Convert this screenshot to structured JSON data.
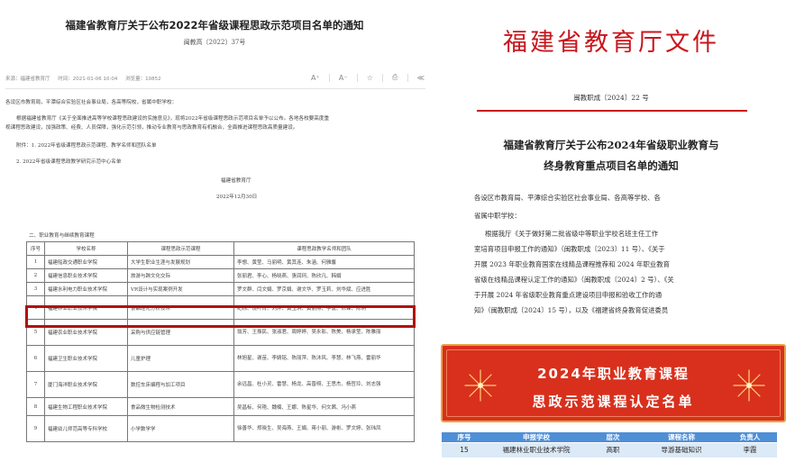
{
  "left_doc": {
    "title": "福建省教育厅关于公布2022年省级课程思政示范项目名单的通知",
    "doc_number": "闽教高〔2022〕37号",
    "meta": {
      "source": "来源：福建省教育厅",
      "publish_time": "时间：2021-01-06 10:04",
      "views": "浏览量：10852"
    },
    "tools": {
      "font_up": "A⁺",
      "font_down": "A⁻",
      "favorite": "☆",
      "print": "⎙",
      "share": "≪"
    },
    "salutation": "各设区市教育局，平潭综合实验区社会事业局，各高等院校，省属中职学校：",
    "body_line1": "根据福建省教育厅《关于全面推进高等学校课程思政建设的实施意见》，现将2022年省级课程思政示范项目名单予以公布。各地各校要高度重",
    "body_line2": "视课程思政建设，加强政策、经费、人员保障，强化示范引领，推动专业教育与思政教育有机融合，全面推进课程思政高质量建设。",
    "attach1": "附件：1. 2022年省级课程思政示范课程、教学名师和团队名单",
    "attach2": "2. 2022年省级课程思政教学研究示范中心名单",
    "signature": "福建省教育厅",
    "date": "2022年12月30日",
    "section_title": "二、职业教育与继续教育课程",
    "table_headers": [
      "序号",
      "学校名称",
      "课程思政示范课程",
      "课程思政教学名师和团队"
    ],
    "table_rows": [
      {
        "no": "1",
        "school": "福建船政交通职业学院",
        "course": "大学生职业生涯与发展规划",
        "team": "李想、黄莹、马丽明、黄其连、朱涵、何雅馨"
      },
      {
        "no": "2",
        "school": "福建信息职业技术学院",
        "course": "旅游与跨文化交际",
        "team": "张丽君、李心、杨晓燕、張润珂、陈欣凡、韩娟"
      },
      {
        "no": "3",
        "school": "福建水利电力职业技术学院",
        "course": "VR设计与实现案例开发",
        "team": "罗文群、闫文娟、罗京娟、谢文华、罗玉莉、刘华斌、应进胜"
      },
      {
        "no": "4",
        "school": "福建林业职业技术学院",
        "course": "食品理化分析技术",
        "team": "纪标、饶叶青、刘烨、黄玉琪、黄丽燕、李波、陈锋、陈玥"
      },
      {
        "no": "5",
        "school": "福建农业职业技术学院",
        "course": "采购与供应链管理",
        "team": "翁芳、王振民、张淑君、周婷婷、吴永影、陈美、杨承莹、陈雅丽"
      },
      {
        "no": "6",
        "school": "福建卫生职业技术学院",
        "course": "儿童护理",
        "team": "林旭星、谢苗、李婧铭、陈丽萍、陈沐风、李慧、林飞燕、雷丽华"
      },
      {
        "no": "7",
        "school": "厦门海洋职业技术学院",
        "course": "数控车床编程与加工项目",
        "team": "余远昌、杜小灵、雷慧、杨龙、高晋栩、王思杰、杨哲玲、刘志强"
      },
      {
        "no": "8",
        "school": "福建生物工程职业技术学院",
        "course": "食品微生物检测技术",
        "team": "吴昌标、何艳、魏楠、王娜、陈星华、何文茜、冯小燕"
      },
      {
        "no": "9",
        "school": "福建幼儿师范高等专科学校",
        "course": "小学数学学",
        "team": "徐善华、郑晓生、吴海燕、王娟、蒋小丽、游彬、罗文婷、张玮凤"
      }
    ]
  },
  "right_doc": {
    "header": "福建省教育厅文件",
    "doc_number": "闽教职成〔2024〕22 号",
    "title_line1": "福建省教育厅关于公布2024年省级职业教育与",
    "title_line2": "终身教育重点项目名单的通知",
    "salutation_line1": "各设区市教育局、平潭综合实验区社会事业局、各高等学校、各",
    "salutation_line2": "省属中职学校：",
    "body_lines": [
      "根据我厅《关于做好第二批省级中等职业学校名班主任工作",
      "室培育项目申报工作的通知》（闽教职成〔2023〕11 号）、《关于",
      "开展 2023 年职业教育国家在线精品课程推荐和 2024 年职业教育",
      "省级在线精品课程认定工作的通知》（闽教职成〔2024〕2 号）、《关",
      "于开展 2024 年省级职业教育重点建设项目申报和验收工作的通",
      "知》（闽教职成〔2024〕15 号），以及《福建省终身教育促进委员"
    ],
    "banner_line1": "2024年职业教育课程",
    "banner_line2": "思政示范课程认定名单",
    "table_headers": [
      "序号",
      "申报学校",
      "层次",
      "课程名称",
      "负责人"
    ],
    "table_row": [
      "15",
      "福建林业职业技术学院",
      "高职",
      "导游基础知识",
      "李霞"
    ]
  },
  "colors": {
    "red_header": "#c8161d",
    "highlight_box": "#b01010",
    "banner_bg": "#d8301c",
    "banner_border": "#e8a24a",
    "table_header_blue": "#4f8fd6",
    "table_row_blue": "#dce9f6"
  }
}
